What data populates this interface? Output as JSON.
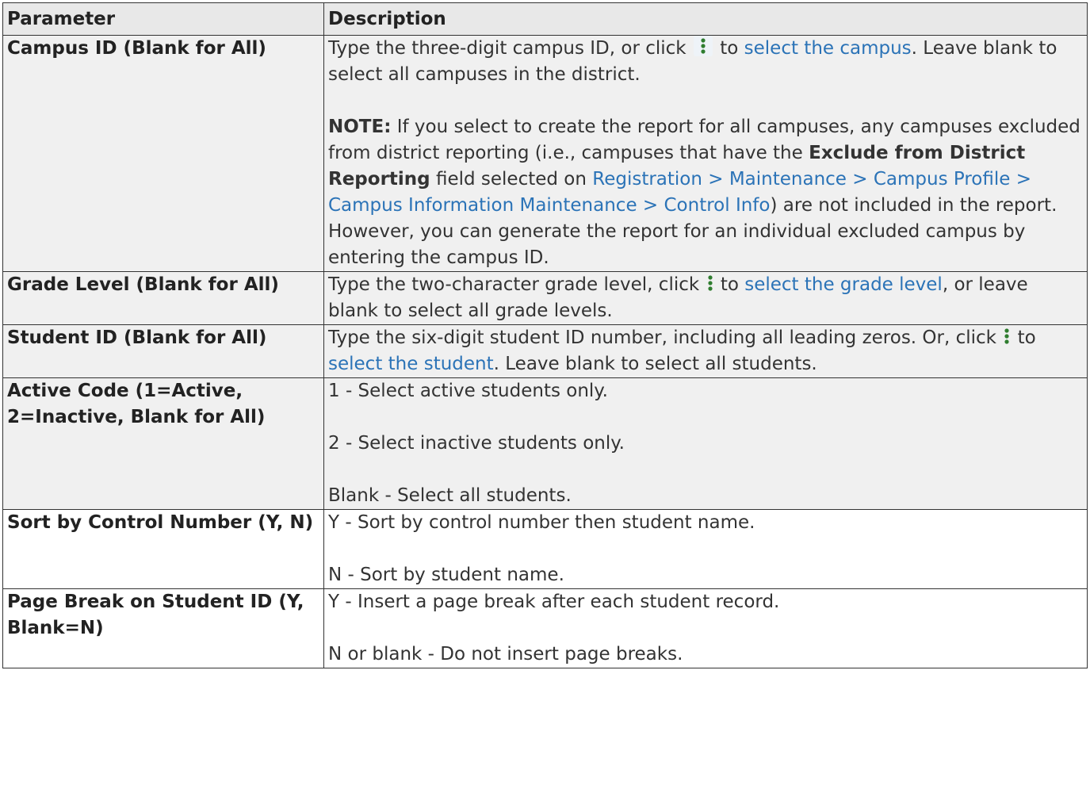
{
  "table": {
    "header": {
      "parameter": "Parameter",
      "description": "Description"
    },
    "rows": [
      {
        "param": "Campus ID (Blank for All)",
        "p1": {
          "a": "Type the three-digit campus ID, or click",
          "b": "to",
          "link": "select the campus",
          "c": ". Leave blank to select all campuses in the district."
        },
        "note": {
          "label": "NOTE:",
          "a": " If you select to create the report for all campuses, any campuses excluded from district reporting (i.e., campuses that have the ",
          "bold": "Exclude from District Reporting",
          "b": " field selected on ",
          "link": "Registration > Maintenance > Campus Profile > Campus Information Maintenance > Control Info",
          "c": ") are not included in the report. However, you can generate the report for an individual excluded campus by entering the campus ID."
        }
      },
      {
        "param": "Grade Level (Blank for All)",
        "a": "Type the two-character grade level, click",
        "b": "to",
        "link": "select the grade level",
        "c": ", or leave blank to select all grade levels."
      },
      {
        "param": "Student ID (Blank for All)",
        "a": "Type the six-digit student ID number, including all leading zeros. Or, click",
        "b": "to",
        "link": "select the student",
        "c": ". Leave blank to select all students."
      },
      {
        "param": "Active Code (1=Active, 2=Inactive, Blank for All)",
        "lines": [
          "1 - Select active students only.",
          "2 - Select inactive students only.",
          "Blank - Select all students."
        ]
      },
      {
        "param": "Sort by Control Number (Y, N)",
        "lines": [
          "Y - Sort by control number then student name.",
          "N - Sort by student name."
        ]
      },
      {
        "param": "Page Break on Student ID (Y, Blank=N)",
        "lines": [
          "Y - Insert a page break after each student record.",
          "N or blank - Do not insert page breaks."
        ]
      }
    ]
  },
  "icons": {
    "lookup": "vertical-dots-icon"
  },
  "colors": {
    "link": "#2b73b7",
    "header_bg": "#e8e8e8",
    "shaded_row_bg": "#f0f0f0",
    "dots": "#2f7d2f"
  }
}
